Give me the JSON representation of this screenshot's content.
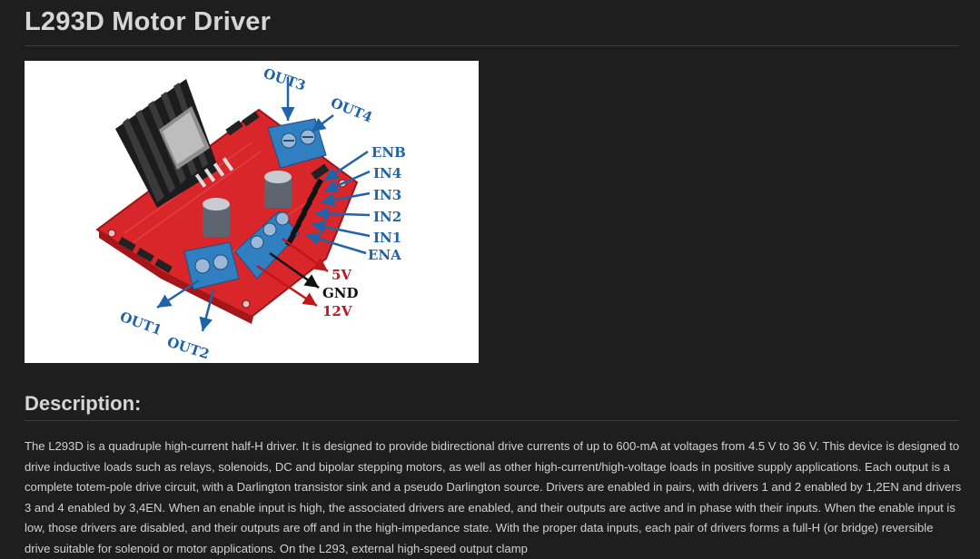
{
  "page": {
    "title": "L293D Motor Driver"
  },
  "figure": {
    "labels": {
      "out1": "OUT1",
      "out2": "OUT2",
      "out3": "OUT3",
      "out4": "OUT4",
      "enb": "ENB",
      "in4": "IN4",
      "in3": "IN3",
      "in2": "IN2",
      "in1": "IN1",
      "ena": "ENA",
      "v5": "5V",
      "gnd": "GND",
      "v12": "12V"
    },
    "colors": {
      "pcb": "#d9262b",
      "terminal": "#2f7fc1",
      "heatsink": "#1c1c1c",
      "label_blue": "#1f63a8",
      "label_red": "#c0161c"
    }
  },
  "description": {
    "heading": "Description:",
    "text": "The L293D is a quadruple high-current half-H driver. It is designed to provide bidirectional drive currents of up to 600-mA at voltages from 4.5 V to 36 V. This device is designed to drive inductive loads such as relays, solenoids, DC and bipolar stepping motors, as well as other high-current/high-voltage loads in positive supply applications. Each output is a complete totem-pole drive circuit, with a Darlington transistor sink and a pseudo Darlington source. Drivers are enabled in pairs, with drivers 1 and 2 enabled by 1,2EN and drivers 3 and 4 enabled by 3,4EN. When an enable input is high, the associated drivers are enabled, and their outputs are active and in phase with their inputs. When the enable input is low, those drivers are disabled, and their outputs are off and in the high-impedance state. With the proper data inputs, each pair of drivers forms a full-H (or bridge) reversible drive suitable for solenoid or motor applications. On the L293, external high-speed output clamp"
  }
}
